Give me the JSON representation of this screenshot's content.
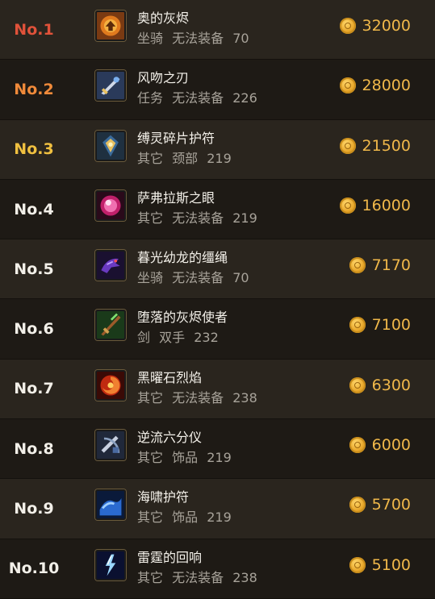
{
  "colors": {
    "rank1": "#e0523a",
    "rank2": "#f08a3a",
    "rank3": "#f0c040",
    "rank_default": "#f2efe8",
    "price": "#f0b84a"
  },
  "items": [
    {
      "rank": "No.1",
      "name": "奥的灰烬",
      "type": "坐骑",
      "slot": "无法装备",
      "level": "70",
      "price": "32000",
      "icon": "ashes-mount-icon"
    },
    {
      "rank": "No.2",
      "name": "风吻之刃",
      "type": "任务",
      "slot": "无法装备",
      "level": "226",
      "price": "28000",
      "icon": "blade-icon"
    },
    {
      "rank": "No.3",
      "name": "缚灵碎片护符",
      "type": "其它",
      "slot": "颈部",
      "level": "219",
      "price": "21500",
      "icon": "amulet-icon"
    },
    {
      "rank": "No.4",
      "name": "萨弗拉斯之眼",
      "type": "其它",
      "slot": "无法装备",
      "level": "219",
      "price": "16000",
      "icon": "pink-orb-icon"
    },
    {
      "rank": "No.5",
      "name": "暮光幼龙的缰绳",
      "type": "坐骑",
      "slot": "无法装备",
      "level": "70",
      "price": "7170",
      "icon": "drake-reins-icon"
    },
    {
      "rank": "No.6",
      "name": "堕落的灰烬使者",
      "type": "剑",
      "slot": "双手",
      "level": "232",
      "price": "7100",
      "icon": "sword-icon"
    },
    {
      "rank": "No.7",
      "name": "黑曜石烈焰",
      "type": "其它",
      "slot": "无法装备",
      "level": "238",
      "price": "6300",
      "icon": "fire-swirl-icon"
    },
    {
      "rank": "No.8",
      "name": "逆流六分仪",
      "type": "其它",
      "slot": "饰品",
      "level": "219",
      "price": "6000",
      "icon": "sextant-icon"
    },
    {
      "rank": "No.9",
      "name": "海啸护符",
      "type": "其它",
      "slot": "饰品",
      "level": "219",
      "price": "5700",
      "icon": "tsunami-icon"
    },
    {
      "rank": "No.10",
      "name": "雷霆的回响",
      "type": "其它",
      "slot": "无法装备",
      "level": "238",
      "price": "5100",
      "icon": "lightning-icon"
    }
  ]
}
